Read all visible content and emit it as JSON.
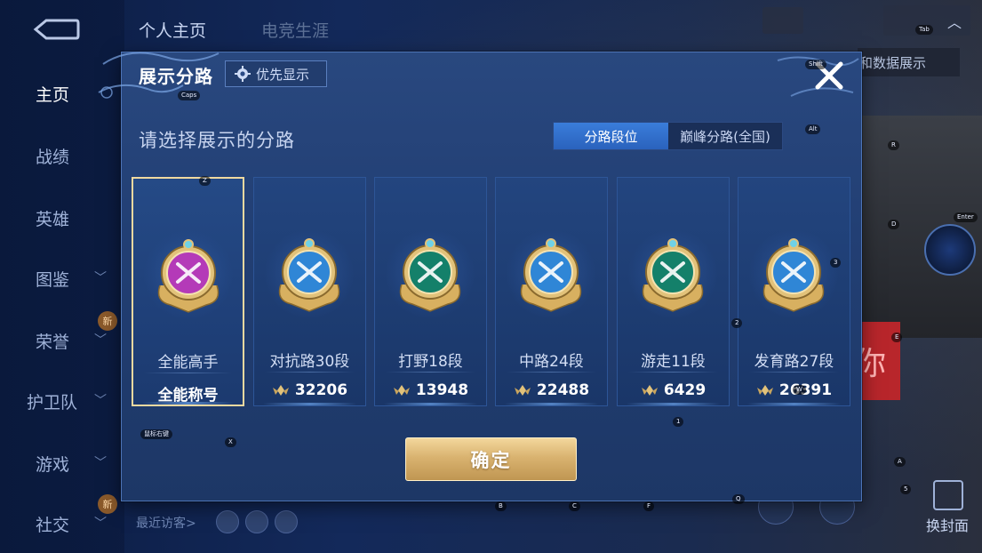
{
  "nav": {
    "items": [
      "主页",
      "战绩",
      "英雄",
      "图鉴",
      "荣誉",
      "护卫队",
      "游戏",
      "社交"
    ],
    "new_badge": "新"
  },
  "top_tabs": [
    "个人主页",
    "电竞生涯"
  ],
  "background": {
    "data_show_text": "和数据展示",
    "banner_char": "你",
    "change_cover": "换封面",
    "recent_visitors": "最近访客>"
  },
  "dialog": {
    "title": "展示分路",
    "priority_button": "优先显示",
    "subtitle": "请选择展示的分路",
    "segment_tabs": [
      "分路段位",
      "巅峰分路(全国)"
    ],
    "selected_segment": "分路段位",
    "confirm": "确定"
  },
  "cards": [
    {
      "label": "全能高手",
      "score": "全能称号",
      "selected": true,
      "color": "#b43ab8",
      "icon": "all-round-emblem-icon"
    },
    {
      "label": "对抗路30段",
      "score": "32206",
      "selected": false,
      "color": "#2f86d6",
      "icon": "clash-lane-emblem-icon"
    },
    {
      "label": "打野18段",
      "score": "13948",
      "selected": false,
      "color": "#14806a",
      "icon": "jungle-emblem-icon"
    },
    {
      "label": "中路24段",
      "score": "22488",
      "selected": false,
      "color": "#2f86d6",
      "icon": "mid-lane-emblem-icon"
    },
    {
      "label": "游走11段",
      "score": "6429",
      "selected": false,
      "color": "#14806a",
      "icon": "roam-emblem-icon"
    },
    {
      "label": "发育路27段",
      "score": "26391",
      "selected": false,
      "color": "#2f86d6",
      "icon": "farm-lane-emblem-icon"
    }
  ],
  "key_hints": {
    "tab": "Tab",
    "shift": "Shift",
    "caps": "Caps",
    "alt": "Alt",
    "r": "R",
    "z": "Z",
    "enter": "Enter",
    "d": "D",
    "three": "3",
    "two": "2",
    "e": "E",
    "w": "W",
    "one": "1",
    "x": "X",
    "mouse_right": "鼠标右键",
    "a": "A",
    "five": "5",
    "b": "B",
    "c": "C",
    "f": "F",
    "q": "Q"
  },
  "colors": {
    "accent_gold": "#f0d9a0",
    "segment_active": "#3a7ddb",
    "dialog_bg": "#29487f"
  }
}
